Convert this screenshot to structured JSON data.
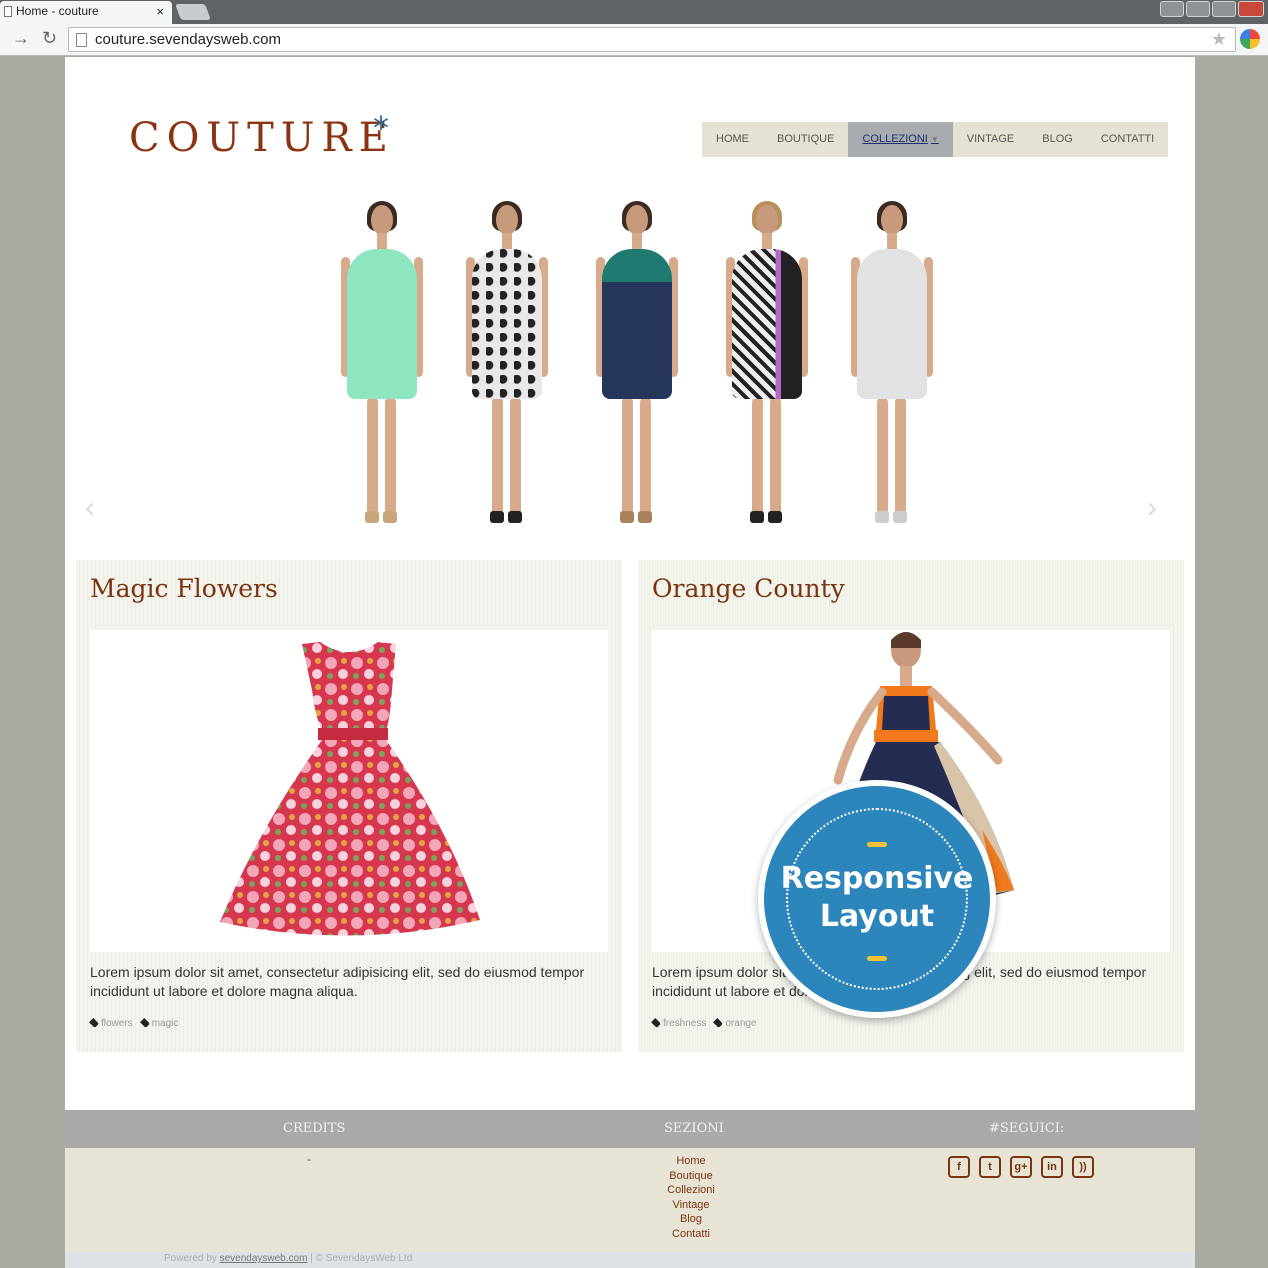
{
  "browser": {
    "tab_title": "Home - couture",
    "tab_close": "×",
    "url": "couture.sevendaysweb.com"
  },
  "site": {
    "logo": "COUTURE",
    "logo_star": "*",
    "nav": [
      {
        "label": "HOME"
      },
      {
        "label": "BOUTIQUE"
      },
      {
        "label": "COLLEZIONI",
        "active": true
      },
      {
        "label": "VINTAGE"
      },
      {
        "label": "BLOG"
      },
      {
        "label": "CONTATTI"
      }
    ],
    "slider_prev": "‹",
    "slider_next": "›"
  },
  "cards": [
    {
      "title": "Magic Flowers",
      "text": "Lorem ipsum dolor sit amet, consectetur adipisicing elit, sed do eiusmod tempor incididunt ut labore et dolore magna aliqua.",
      "tags": [
        "flowers",
        "magic"
      ]
    },
    {
      "title": "Orange County",
      "text": "Lorem ipsum dolor sit amet, consectetur adipisicing elit, sed do eiusmod tempor incididunt ut labore et dolore magna aliqua.",
      "tags": [
        "freshness",
        "orange"
      ]
    }
  ],
  "badge": {
    "line1": "Responsive",
    "line2": "Layout"
  },
  "footer": {
    "credits_title": "CREDITS",
    "credits_value": "-",
    "sections_title": "SEZIONI",
    "sections": [
      "Home",
      "Boutique",
      "Collezioni",
      "Vintage",
      "Blog",
      "Contatti"
    ],
    "follow_title": "#SEGUICI:",
    "social": [
      {
        "icon": "facebook-icon",
        "glyph": "f"
      },
      {
        "icon": "twitter-icon",
        "glyph": "t"
      },
      {
        "icon": "google-plus-icon",
        "glyph": "g+"
      },
      {
        "icon": "linkedin-icon",
        "glyph": "in"
      },
      {
        "icon": "rss-icon",
        "glyph": "))"
      }
    ],
    "powered_by": "Powered by",
    "powered_link": "sevendaysweb.com",
    "copyright": "| © SevendaysWeb Ltd"
  },
  "colors": {
    "brand": "#8b3412",
    "badge_blue": "#2c86bb",
    "nav_bg": "#e5e2d4",
    "nav_active_bg": "#a9acae"
  }
}
